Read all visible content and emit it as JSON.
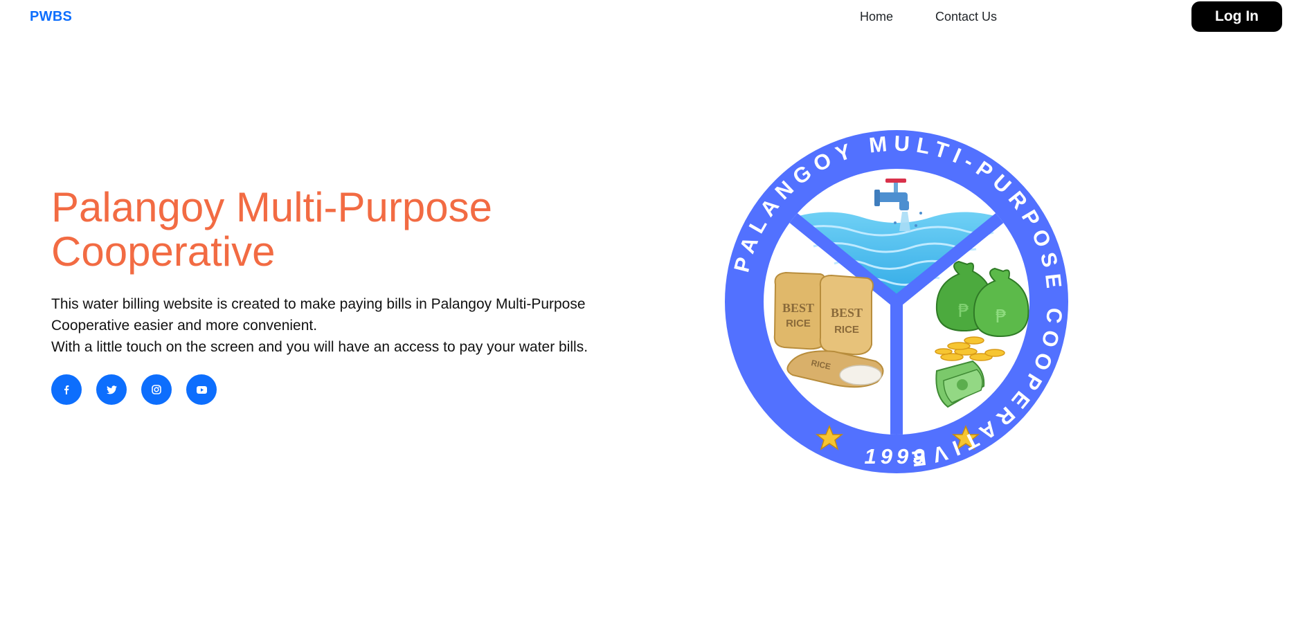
{
  "navbar": {
    "brand": "PWBS",
    "links": [
      {
        "label": "Home"
      },
      {
        "label": "Contact Us"
      }
    ],
    "login_label": "Log In"
  },
  "hero": {
    "title": "Palangoy Multi-Purpose Cooperative",
    "paragraph_1": "This water billing website is created to make paying bills in Palangoy Multi-Purpose Cooperative easier and more convenient.",
    "paragraph_2": "With a little touch on the screen and you will have an access to pay your water bills."
  },
  "socials": [
    {
      "icon": "facebook-icon"
    },
    {
      "icon": "twitter-icon"
    },
    {
      "icon": "instagram-icon"
    },
    {
      "icon": "youtube-icon"
    }
  ],
  "logo": {
    "ring_text": "PALANGOY MULTI-PURPOSE COOPERATIVE",
    "year": "1999",
    "sack_label_1": "BEST",
    "sack_label_2": "RICE",
    "sack_label_3": "RICE",
    "currency_symbol": "₱"
  },
  "colors": {
    "brand": "#0d6efd",
    "title": "#f26b43",
    "logo_ring": "#5271ff",
    "login_bg": "#000000"
  }
}
